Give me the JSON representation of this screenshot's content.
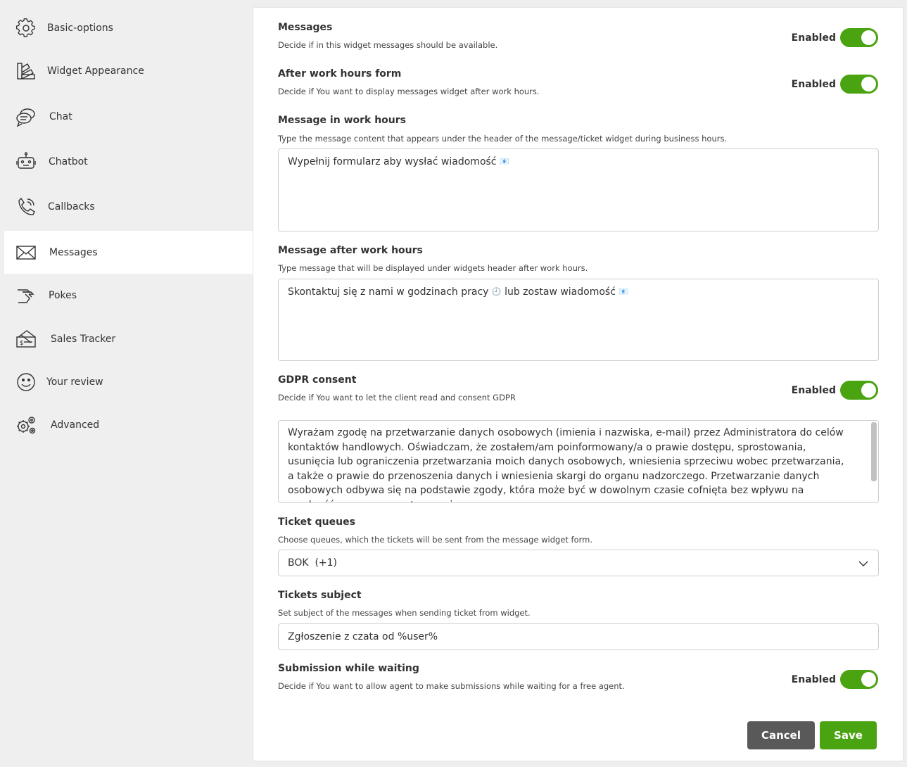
{
  "sidebar": {
    "items": [
      {
        "label": "Basic-options",
        "icon": "gear-icon"
      },
      {
        "label": "Widget Appearance",
        "icon": "palette-icon"
      },
      {
        "label": "Chat",
        "icon": "chat-bubbles-icon"
      },
      {
        "label": "Chatbot",
        "icon": "robot-icon"
      },
      {
        "label": "Callbacks",
        "icon": "phone-icon"
      },
      {
        "label": "Messages",
        "icon": "envelope-icon",
        "active": true
      },
      {
        "label": "Pokes",
        "icon": "poke-hand-icon"
      },
      {
        "label": "Sales Tracker",
        "icon": "sales-tag-icon"
      },
      {
        "label": "Your review",
        "icon": "smiley-icon"
      },
      {
        "label": "Advanced",
        "icon": "gears-icon"
      }
    ]
  },
  "form": {
    "messages": {
      "title": "Messages",
      "desc": "Decide if in this widget messages should be available.",
      "toggle_label": "Enabled"
    },
    "after_hours_form": {
      "title": "After work hours form",
      "desc": "Decide if You want to display messages widget after work hours.",
      "toggle_label": "Enabled"
    },
    "msg_work_hours": {
      "title": "Message in work hours",
      "desc": "Type the message content that appears under the header of the message/ticket widget during business hours.",
      "value": "Wypełnij formularz aby wysłać wiadomość",
      "emoji": "📧"
    },
    "msg_after_hours": {
      "title": "Message after work hours",
      "desc": "Type message that will be displayed under widgets header after work hours.",
      "value_part1": "Skontaktuj się z nami w godzinach pracy",
      "emoji1": "🕘",
      "value_part2": "lub zostaw wiadomość",
      "emoji2": "📧"
    },
    "gdpr": {
      "title": "GDPR consent",
      "desc": "Decide if You want to let the client read and consent GDPR",
      "toggle_label": "Enabled",
      "text": "Wyrażam zgodę na przetwarzanie danych osobowych (imienia i nazwiska, e-mail) przez Administratora do celów kontaktów handlowych. Oświadczam, że zostałem/am poinformowany/a o prawie dostępu, sprostowania, usunięcia lub ograniczenia przetwarzania moich danych osobowych, wniesienia sprzeciwu wobec przetwarzania, a także o prawie do przenoszenia danych i wniesienia skargi do organu nadzorczego. Przetwarzanie danych osobowych odbywa się na podstawie zgody, która może być w dowolnym czasie cofnięta bez wpływu na zgodność z prawem przetwarzania"
    },
    "ticket_queues": {
      "title": "Ticket queues",
      "desc": "Choose queues, which the tickets will be sent from the message widget form.",
      "selected": "BOK  (+1)"
    },
    "tickets_subject": {
      "title": "Tickets subject",
      "desc": "Set subject of the messages when sending ticket from widget.",
      "value": "Zgłoszenie z czata od %user%"
    },
    "submission_waiting": {
      "title": "Submission while waiting",
      "desc": "Decide if You want to allow agent to make submissions while waiting for a free agent.",
      "toggle_label": "Enabled"
    }
  },
  "buttons": {
    "cancel": "Cancel",
    "save": "Save"
  },
  "colors": {
    "accent": "#4aa311",
    "cancel": "#595959"
  }
}
